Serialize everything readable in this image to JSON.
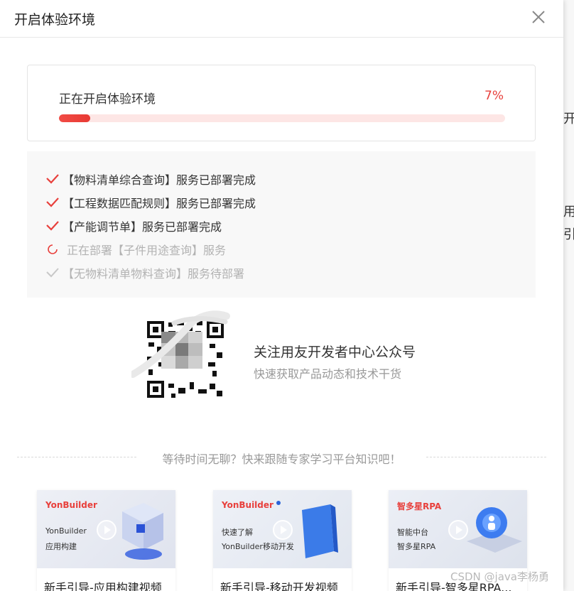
{
  "dialog": {
    "title": "开启体验环境",
    "close_icon": "close-icon"
  },
  "progress": {
    "label": "正在开启体验环境",
    "percent_text": "7%",
    "value_fraction": 0.07,
    "accent_color": "#e8403c"
  },
  "status_items": [
    {
      "state": "done",
      "text": "【物料清单综合查询】服务已部署完成",
      "icon": "check-icon"
    },
    {
      "state": "done",
      "text": "【工程数据匹配规则】服务已部署完成",
      "icon": "check-icon"
    },
    {
      "state": "done",
      "text": "【产能调节单】服务已部署完成",
      "icon": "check-icon"
    },
    {
      "state": "running",
      "text": "正在部署【子件用途查询】服务",
      "icon": "spinner-icon"
    },
    {
      "state": "pending",
      "text": "【无物料清单物料查询】服务待部署",
      "icon": "check-icon"
    }
  ],
  "follow": {
    "title": "关注用友开发者中心公众号",
    "subtitle": "快速获取产品动态和技术干货",
    "qr_icon": "qr-code-icon"
  },
  "divider_text": "等待时间无聊？快来跟随专家学习平台知识吧！",
  "cards": [
    {
      "brand": "YonBuilder",
      "brand_color": "#e8403c",
      "line1": "YonBuilder",
      "line2": "应用构建",
      "title": "新手引导-应用构建视频"
    },
    {
      "brand": "YonBuilder",
      "brand_color": "#e8403c",
      "line1": "快速了解",
      "line2": "YonBuilder移动开发",
      "title": "新手引导-移动开发视频"
    },
    {
      "brand": "智多星RPA",
      "brand_color": "#e8403c",
      "line1": "智能中台",
      "line2": "智多星RPA",
      "title": "新手引导-智多星RPA..."
    }
  ],
  "background_chars": [
    "开",
    "用有",
    "引最"
  ],
  "watermark": "CSDN @java李杨勇"
}
